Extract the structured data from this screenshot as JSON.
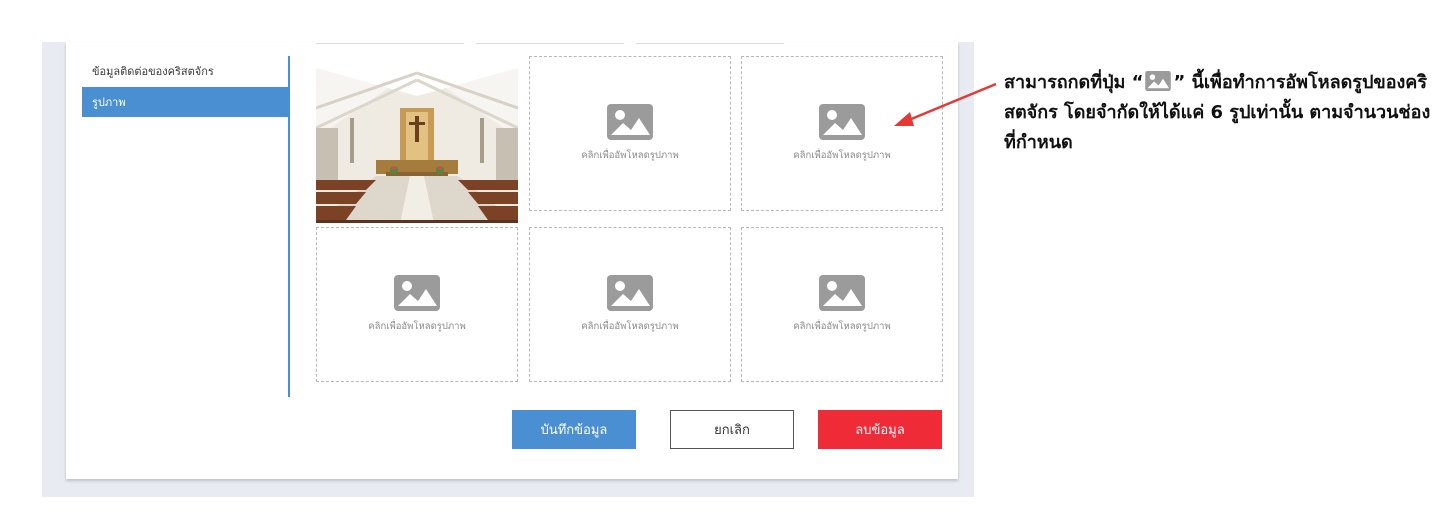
{
  "sidebar": {
    "items": [
      {
        "label": "ข้อมูลติดต่อของคริสตจักร"
      },
      {
        "label": "รูปภาพ"
      }
    ]
  },
  "gallery": {
    "upload_label": "คลิกเพื่ออัพโหลดรูปภาพ",
    "icon": "image-placeholder-icon",
    "max_images": 6
  },
  "buttons": {
    "save_label": "บันทึกข้อมูล",
    "cancel_label": "ยกเลิก",
    "delete_label": "ลบข้อมูล"
  },
  "annotation": {
    "part1": "สามารถกดที่ปุ่ม “",
    "part2": "” นี้เพื่อทำการอัพโหลดรูปของคริสตจักร โดยจำกัดให้ได้แค่ 6 รูปเท่านั้น ตามจำนวนช่องที่กำหนด"
  },
  "colors": {
    "accent": "#4a8fd1",
    "danger": "#ee2b36",
    "arrow": "#e53935"
  }
}
